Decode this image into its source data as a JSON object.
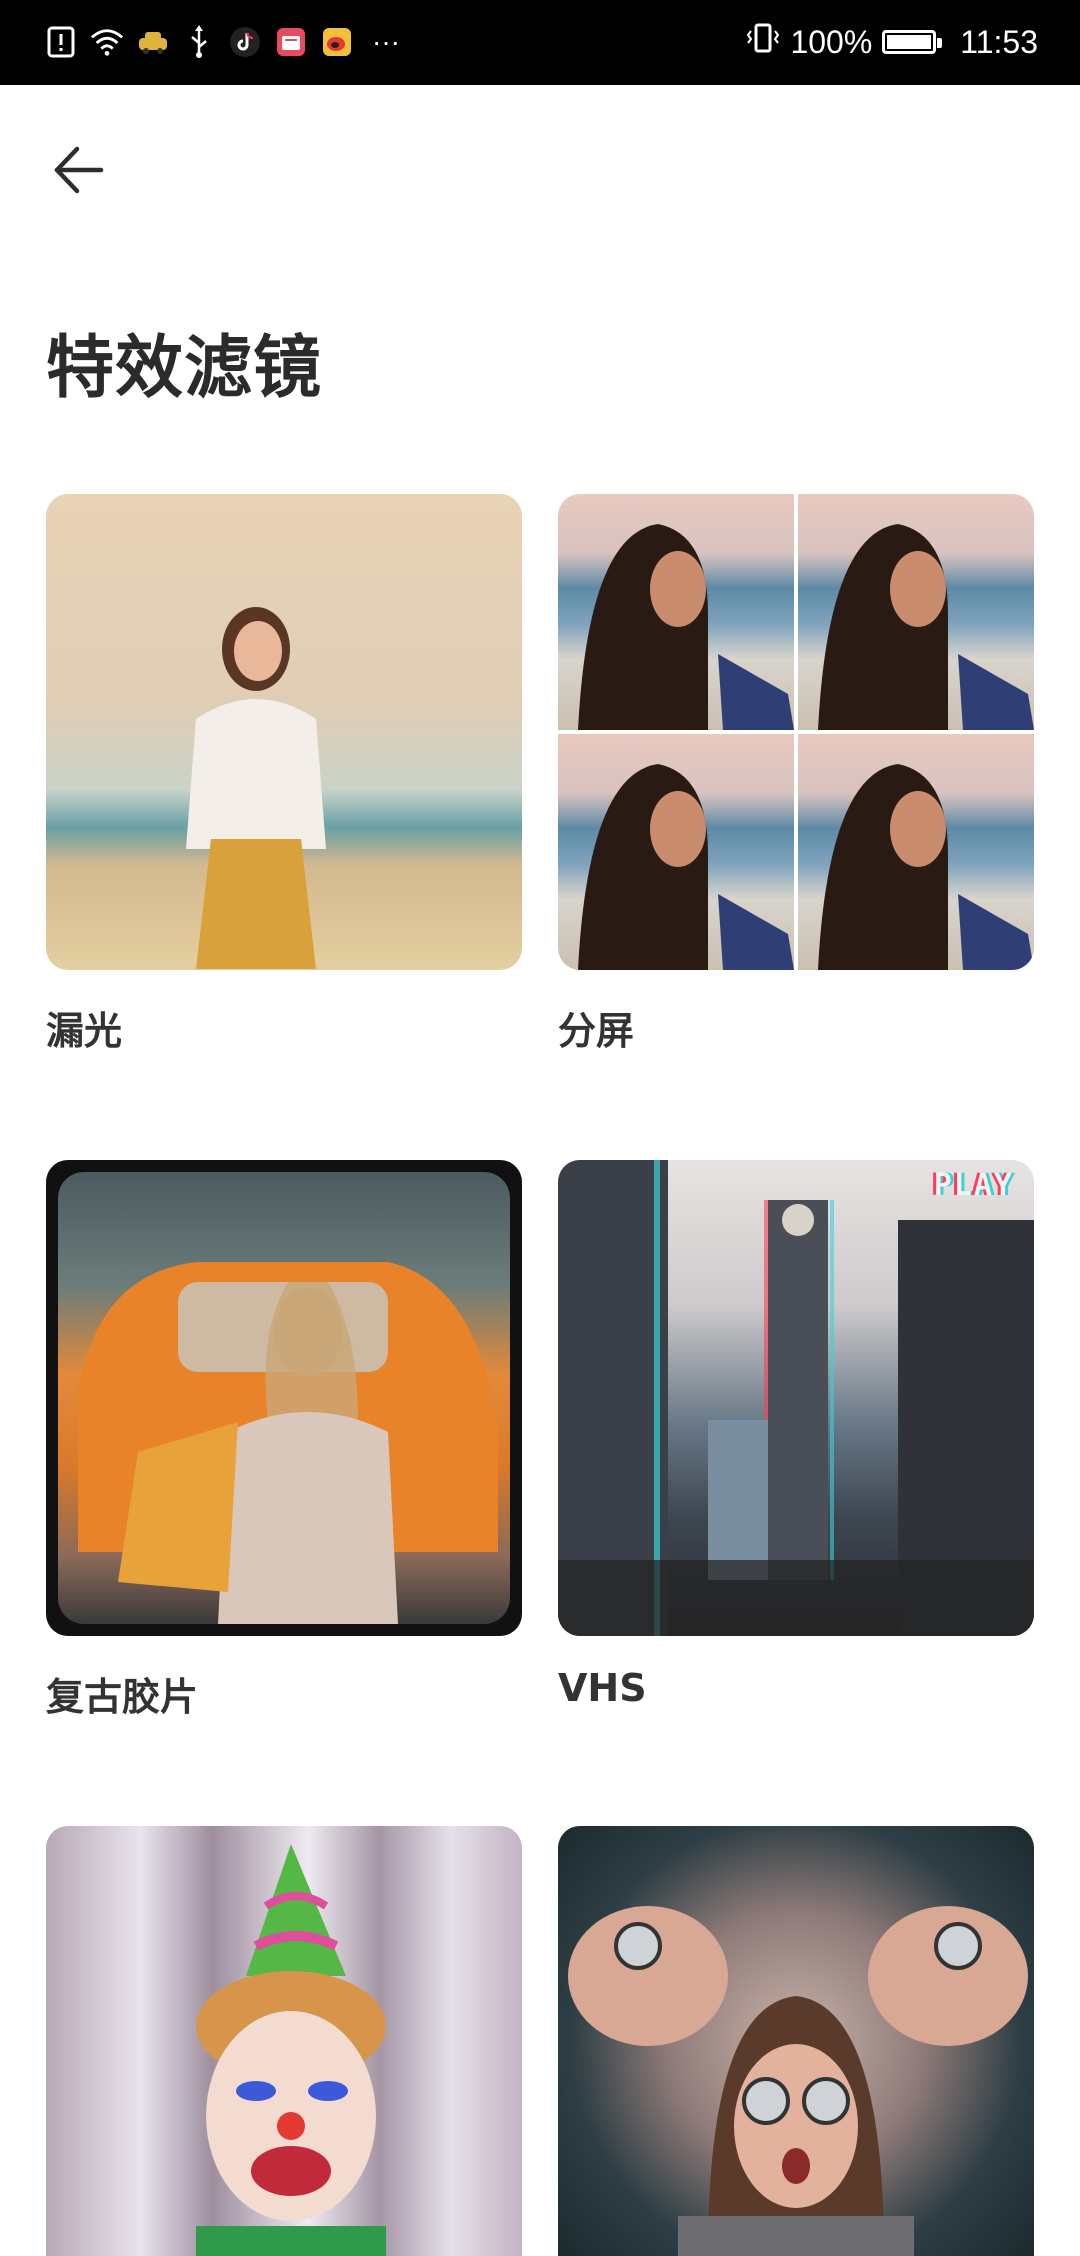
{
  "status_bar": {
    "icons": [
      "alert-icon",
      "wifi-icon",
      "taxi-app-icon",
      "usb-icon",
      "tiktok-icon",
      "shopping-icon",
      "weibo-icon",
      "more-dots-icon"
    ],
    "more": "···",
    "battery_percent": "100%",
    "time": "11:53"
  },
  "header": {
    "back": "arrow-left-icon"
  },
  "page": {
    "title": "特效滤镜"
  },
  "filters": [
    {
      "label": "漏光"
    },
    {
      "label": "分屏"
    },
    {
      "label": "复古胶片"
    },
    {
      "label": "VHS"
    },
    {
      "label": ""
    },
    {
      "label": ""
    }
  ],
  "overlays": {
    "vhs_play": "PLAY"
  }
}
